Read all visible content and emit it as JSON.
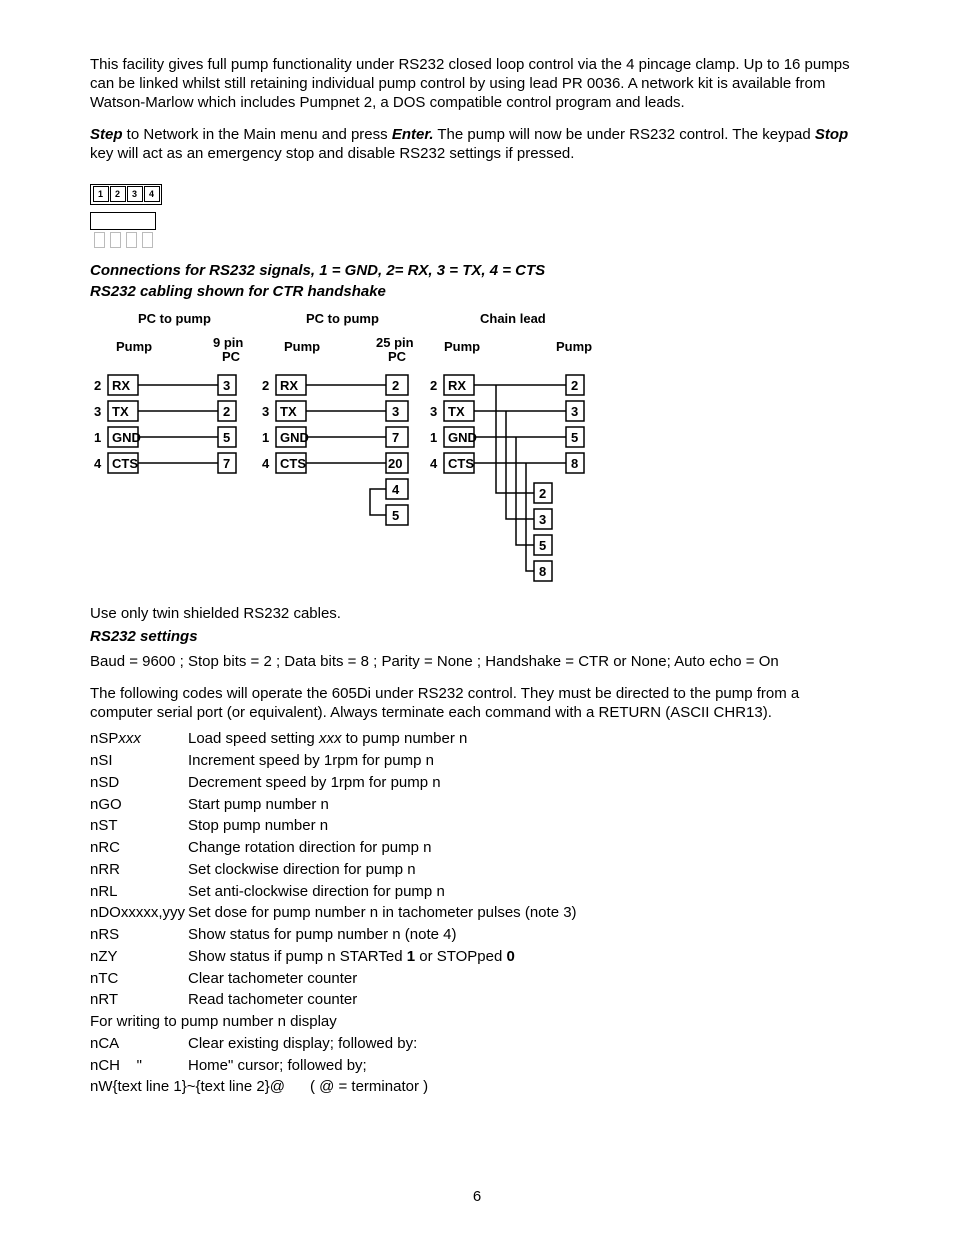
{
  "intro": {
    "para1": "This facility gives full pump functionality under RS232 closed loop control via the 4 pincage clamp. Up to 16 pumps can be linked whilst still retaining individual pump control by using lead PR 0036. A network kit is available from Watson-Marlow which includes Pumpnet 2, a DOS compatible control program and leads.",
    "step_word": "Step",
    "para2_a": " to Network in the Main menu and press ",
    "enter_word": "Enter.",
    "para2_b": " The pump will now be under RS232 control. The keypad ",
    "stop_word": "Stop",
    "para2_c": " key will act as an emergency stop and disable RS232 settings if pressed."
  },
  "headings": {
    "conn_a": "Connections for RS232 signals, ",
    "conn_b": "1 = GND, 2= RX, 3 = TX, 4 = CTS",
    "cabling": "RS232 cabling shown for CTR handshake",
    "settings": "RS232 settings"
  },
  "wiring": {
    "col1": "PC to pump",
    "col2": "PC to pump",
    "col3": "Chain lead",
    "pump": "Pump",
    "pc9": "9 pin PC",
    "pc25": "25 pin PC",
    "signals": [
      "RX",
      "TX",
      "GND",
      "CTS"
    ]
  },
  "note_cable": "Use only twin shielded RS232 cables.",
  "baud_line": "Baud = 9600 ;  Stop bits = 2 ; Data bits = 8 ; Parity = None ; Handshake = CTR or None; Auto echo = On",
  "codes_intro": "The following codes will operate the 605Di under RS232 control. They must be directed to the pump from a computer serial port (or equivalent). Always terminate each command with a RETURN (ASCII CHR13).",
  "cmds": [
    {
      "c": "nSPxxx",
      "c_ital_tail": "xxx",
      "d": "Load speed setting xxx to pump number n",
      "d_ital": "xxx"
    },
    {
      "c": "nSI",
      "d": "Increment speed by 1rpm for pump n"
    },
    {
      "c": "nSD",
      "d": "Decrement speed by 1rpm for pump n"
    },
    {
      "c": "nGO",
      "d": "Start pump number n"
    },
    {
      "c": "nST",
      "d": "Stop pump number n"
    },
    {
      "c": "nRC",
      "d": "Change rotation direction for pump n"
    },
    {
      "c": "nRR",
      "d": "Set clockwise direction for pump n"
    },
    {
      "c": "nRL",
      "d": "Set anti-clockwise direction for pump n"
    },
    {
      "c": "nDOxxxxx,yyy",
      "d": "Set dose for pump number n in tachometer pulses (note 3)"
    },
    {
      "c": "nRS",
      "d": "Show status for pump number n (note 4)"
    },
    {
      "c": "nZY",
      "d": "Show status if pump n STARTed 1 or STOPped 0",
      "bold": [
        "1",
        "0"
      ]
    },
    {
      "c": "nTC",
      "d": "Clear tachometer counter"
    },
    {
      "c": "nRT",
      "d": "Read tachometer counter"
    }
  ],
  "write_line": "For writing to pump number n display",
  "cmds2": [
    {
      "c": "nCA",
      "d": "Clear existing display; followed by:"
    },
    {
      "c": "nCH    \"",
      "d": "Home\" cursor; followed by;"
    }
  ],
  "lastline": "nW{text line 1}~{text line 2}@      ( @ = terminator )",
  "pagenum": "6"
}
